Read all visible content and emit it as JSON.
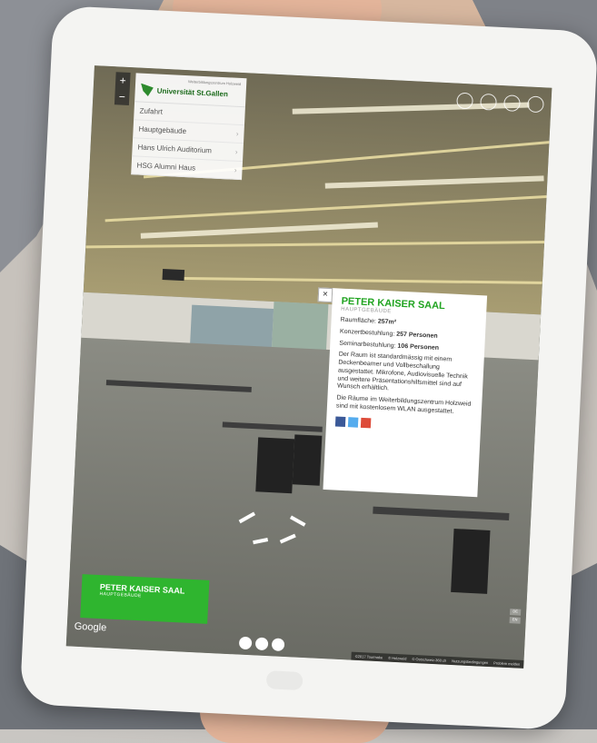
{
  "menu": {
    "top_line": "Weiterbildungszentrum Holzweid",
    "brand": "Universität St.Gallen",
    "items": [
      {
        "label": "Zufahrt",
        "has_submenu": false
      },
      {
        "label": "Hauptgebäude",
        "has_submenu": true
      },
      {
        "label": "Hans Ulrich Auditorium",
        "has_submenu": true
      },
      {
        "label": "HSG Alumni Haus",
        "has_submenu": true
      }
    ]
  },
  "zoom": {
    "in": "+",
    "out": "−"
  },
  "info": {
    "title": "PETER KAISER SAAL",
    "subtitle": "HAUPTGEBÄUDE",
    "area_label": "Raumfläche: ",
    "area_value": "257m²",
    "concert_label": "Konzertbestuhlung: ",
    "concert_value": "257 Personen",
    "seminar_label": "Seminarbestuhlung: ",
    "seminar_value": "106 Personen",
    "description": "Der Raum ist standardmässig mit einem Deckenbeamer und Vollbeschallung ausgestattet. Mikrofone, Audiovisuelle Technik und weitere Präsentationshilfsmittel sind auf Wunsch erhältlich.",
    "wlan_note": "Die Räume im Weiterbildungszentrum Holzweid sind mit kostenlosem WLAN ausgestattet.",
    "close": "×",
    "social": [
      "facebook",
      "twitter",
      "google-plus"
    ]
  },
  "label_card": {
    "title": "PETER KAISER SAAL",
    "subtitle": "HAUPTGEBÄUDE"
  },
  "google_logo": "Google",
  "footer": [
    "©2017 Tourmake",
    "© Holzweid",
    "© Ostschweiz-360.ch",
    "Nutzungsbedingungen",
    "Problem melden"
  ],
  "lang_strip": [
    "DE",
    "EN"
  ],
  "colors": {
    "accent": "#2fb52f",
    "title_green": "#22a422"
  }
}
